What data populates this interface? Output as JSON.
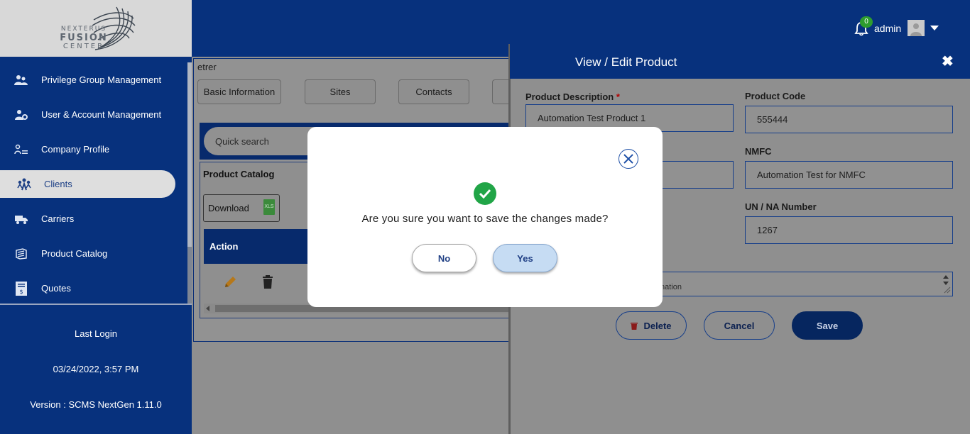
{
  "logo": {
    "line1": "NEXTERUS",
    "line2": "FUSION",
    "line3": "CENTER"
  },
  "sidebar": {
    "items": [
      {
        "label": "Privilege Group Management",
        "icon": "users-icon"
      },
      {
        "label": "User & Account Management",
        "icon": "user-gear-icon"
      },
      {
        "label": "Company Profile",
        "icon": "profile-icon"
      },
      {
        "label": "Clients",
        "icon": "clients-icon",
        "active": true
      },
      {
        "label": "Carriers",
        "icon": "truck-icon"
      },
      {
        "label": "Product Catalog",
        "icon": "catalog-icon"
      },
      {
        "label": "Quotes",
        "icon": "quote-icon"
      }
    ],
    "last_login_label": "Last Login",
    "last_login_value": "03/24/2022, 3:57 PM",
    "version": "Version : SCMS NextGen 1.11.0"
  },
  "header": {
    "notification_count": "0",
    "user": "admin"
  },
  "main": {
    "client_name": "etrer",
    "tabs": [
      "Basic Information",
      "Sites",
      "Contacts"
    ],
    "search_placeholder": "Quick search",
    "catalog_title": "Product Catalog",
    "download_label": "Download",
    "xls_label": "XLS",
    "table_header": "Action"
  },
  "panel": {
    "title": "View / Edit Product",
    "close_glyph": "✖",
    "fields": {
      "product_description_label": "Product Description",
      "product_description_value": "Automation Test Product 1",
      "product_code_label": "Product Code",
      "product_code_value": "555444",
      "nmfc_label": "NMFC",
      "nmfc_value": "Automation Test for NMFC",
      "un_na_label": "UN / NA Number",
      "un_na_value": "1267",
      "notes_partial": "nation"
    },
    "buttons": {
      "delete": "Delete",
      "cancel": "Cancel",
      "save": "Save"
    }
  },
  "modal": {
    "message": "Are you sure you want to save the changes made?",
    "no_label": "No",
    "yes_label": "Yes"
  },
  "colors": {
    "brand_navy": "#07317d",
    "success_green": "#21a547",
    "yes_button": "#c6dcf3"
  }
}
